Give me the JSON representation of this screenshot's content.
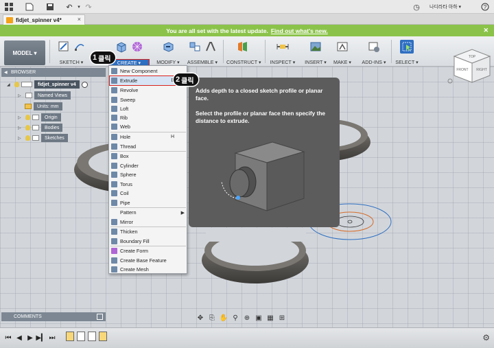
{
  "app": {
    "user_label": "나디라타 아하 ▾"
  },
  "tab": {
    "title": "fidjet_spinner v4*",
    "close": "×"
  },
  "update_bar": {
    "message": "You are all set with the latest update.",
    "link": "Find out what's new."
  },
  "toolbar": {
    "model": "MODEL ▾",
    "groups": [
      "SKETCH ▾",
      "CREATE ▾",
      "MODIFY ▾",
      "ASSEMBLE ▾",
      "CONSTRUCT ▾",
      "INSPECT ▾",
      "INSERT ▾",
      "MAKE ▾",
      "ADD-INS ▾",
      "SELECT ▾"
    ]
  },
  "browser": {
    "title": "BROWSER",
    "nodes": [
      "fidjet_spinner v4",
      "Named Views",
      "Units: mm",
      "Origin",
      "Bodies",
      "Sketches"
    ]
  },
  "create_menu": {
    "items": [
      {
        "label": "New Component",
        "key": "",
        "arrow": ""
      },
      {
        "label": "Extrude",
        "key": "E",
        "arrow": ""
      },
      {
        "label": "Revolve",
        "key": "",
        "arrow": ""
      },
      {
        "label": "Sweep",
        "key": "",
        "arrow": ""
      },
      {
        "label": "Loft",
        "key": "",
        "arrow": ""
      },
      {
        "label": "Rib",
        "key": "",
        "arrow": ""
      },
      {
        "label": "Web",
        "key": "",
        "arrow": ""
      },
      {
        "label": "Hole",
        "key": "H",
        "arrow": ""
      },
      {
        "label": "Thread",
        "key": "",
        "arrow": ""
      },
      {
        "label": "Box",
        "key": "",
        "arrow": ""
      },
      {
        "label": "Cylinder",
        "key": "",
        "arrow": ""
      },
      {
        "label": "Sphere",
        "key": "",
        "arrow": ""
      },
      {
        "label": "Torus",
        "key": "",
        "arrow": ""
      },
      {
        "label": "Coil",
        "key": "",
        "arrow": ""
      },
      {
        "label": "Pipe",
        "key": "",
        "arrow": ""
      },
      {
        "label": "Pattern",
        "key": "",
        "arrow": "▶"
      },
      {
        "label": "Mirror",
        "key": "",
        "arrow": ""
      },
      {
        "label": "Thicken",
        "key": "",
        "arrow": ""
      },
      {
        "label": "Boundary Fill",
        "key": "",
        "arrow": ""
      },
      {
        "label": "Create Form",
        "key": "",
        "arrow": ""
      },
      {
        "label": "Create Base Feature",
        "key": "",
        "arrow": ""
      },
      {
        "label": "Create Mesh",
        "key": "",
        "arrow": ""
      }
    ]
  },
  "tooltip": {
    "line1": "Adds depth to a closed sketch profile or planar face.",
    "line2": "Select the profile or planar face then specify the distance to extrude."
  },
  "badges": [
    {
      "num": "1",
      "text": "클릭"
    },
    {
      "num": "2",
      "text": "클릭"
    }
  ],
  "viewcube": {
    "top": "TOP",
    "front": "FRONT",
    "right": "RIGHT"
  },
  "comments": {
    "title": "COMMENTS"
  },
  "colors": {
    "update_green": "#8bc34a",
    "highlight_red": "#d9231c",
    "select_blue": "#2f6fc1"
  }
}
